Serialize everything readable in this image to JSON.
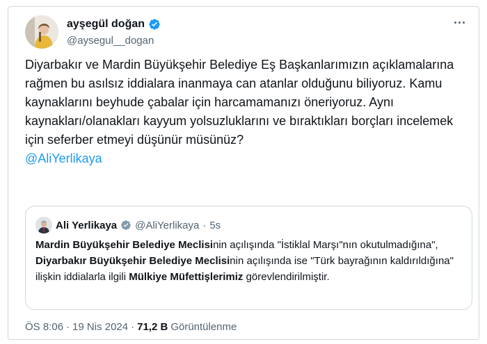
{
  "author": {
    "display_name": "ayşegül doğan",
    "handle": "@aysegul__dogan"
  },
  "tweet": {
    "text": "Diyarbakır ve Mardin Büyükşehir Belediye Eş Başkanlarımızın açıklamalarına rağmen bu asılsız iddialara inanmaya can atanlar olduğunu biliyoruz. Kamu kaynaklarını beyhude çabalar için harcamamanızı öneriyoruz. Aynı kaynakları/olanakları kayyum yolsuzluklarını ve bıraktıkları borçları incelemek için seferber etmeyi düşünür müsünüz?",
    "mention": "@AliYerlikaya"
  },
  "quote": {
    "display_name": "Ali Yerlikaya",
    "handle": "@AliYerlikaya",
    "separator": "·",
    "time": "5s",
    "segments": [
      {
        "bold": "Mardin Büyükşehir Belediye Meclisi",
        "text": "nin açılışında \"İstiklal Marşı\"nın okutulmadığına\", "
      },
      {
        "bold": "Diyarbakır Büyükşehir Belediye Meclisi",
        "text": "nin açılışında ise \"Türk bayrağının kaldırıldığına\" ilişkin iddialarla ilgili "
      },
      {
        "bold": "Mülkiye Müfettişlerimiz",
        "text": " görevlendirilmiştir."
      }
    ]
  },
  "meta": {
    "time": "ÖS 8:06",
    "dot1": "·",
    "date": "19 Nis 2024",
    "dot2": "·",
    "views": "71,2 B",
    "views_label": "Görüntülenme"
  },
  "colors": {
    "accent": "#1d9bf0",
    "muted": "#536471",
    "border": "#cfd9de"
  },
  "icons": {
    "verified": "verified-badge-icon",
    "more": "more-options-icon"
  }
}
